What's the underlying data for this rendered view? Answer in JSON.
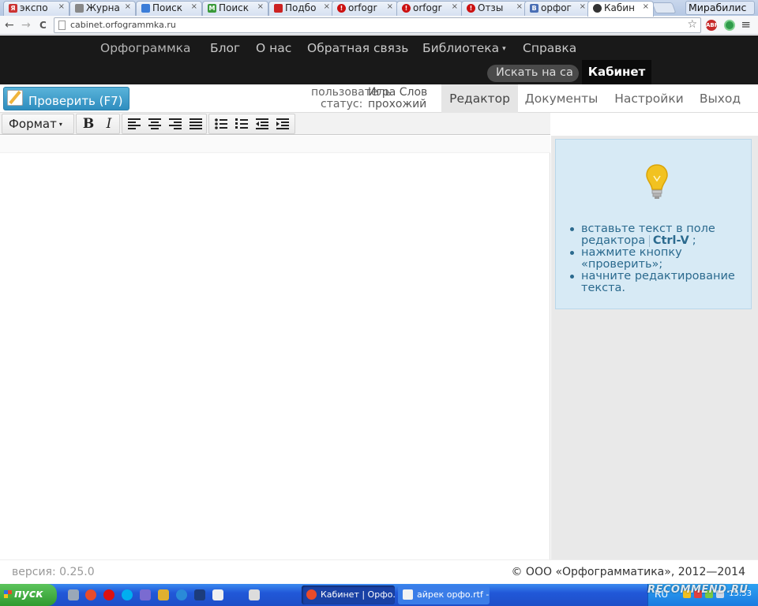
{
  "browser": {
    "tabs": [
      {
        "label": "экспо",
        "favicon_color": "#cc3333",
        "favicon_glyph": "Я"
      },
      {
        "label": "Журна",
        "favicon_color": "#888888",
        "favicon_glyph": ""
      },
      {
        "label": "Поиск",
        "favicon_color": "#3b7dd8",
        "favicon_glyph": ""
      },
      {
        "label": "Поиск",
        "favicon_color": "#3a9a3a",
        "favicon_glyph": "M"
      },
      {
        "label": "Подбо",
        "favicon_color": "#cc2222",
        "favicon_glyph": ""
      },
      {
        "label": "orfogr",
        "favicon_color": "#cc1111",
        "favicon_glyph": "!"
      },
      {
        "label": "orfogr",
        "favicon_color": "#cc1111",
        "favicon_glyph": "!"
      },
      {
        "label": "Отзы",
        "favicon_color": "#cc1111",
        "favicon_glyph": "!"
      },
      {
        "label": "орфог",
        "favicon_color": "#4a6fb5",
        "favicon_glyph": "B"
      },
      {
        "label": "Кабин",
        "favicon_color": "#333333",
        "favicon_glyph": "",
        "active": true
      }
    ],
    "close_glyph": "×",
    "profile_name": "Мирабилис",
    "url": "cabinet.orfogrammka.ru",
    "back_glyph": "←",
    "forward_glyph": "→",
    "reload_glyph": "C",
    "star_glyph": "☆",
    "menu_glyph": "≡",
    "ext_abp_label": "ABP"
  },
  "site_nav": {
    "items": [
      {
        "label": "Орфограммка"
      },
      {
        "label": "Блог"
      },
      {
        "label": "О нас"
      },
      {
        "label": "Обратная связь"
      },
      {
        "label": "Библиотека",
        "dropdown": true
      },
      {
        "label": "Справка"
      }
    ],
    "caret": "▾",
    "search_label": "Искать на са",
    "cabinet_label": "Кабинет"
  },
  "editor_header": {
    "check_button": "Проверить (F7)",
    "user_label": "пользователь",
    "status_label": "статус:",
    "user_name": "Игра Слов",
    "user_status": "прохожий",
    "tabs": [
      {
        "label": "Редактор",
        "active": true
      },
      {
        "label": "Документы"
      },
      {
        "label": "Настройки"
      },
      {
        "label": "Выход"
      }
    ]
  },
  "format_toolbar": {
    "format_label": "Формат",
    "bold": "B",
    "italic": "I"
  },
  "hints": {
    "items": [
      {
        "text": "вставьте текст в поле редактора",
        "kbd": "Ctrl-V",
        "suffix": ";"
      },
      {
        "text": "нажмите кнопку «проверить»;"
      },
      {
        "text": "начните редактирование текста."
      }
    ],
    "bulb_color": "#f2c220"
  },
  "footer": {
    "version": "версия: 0.25.0",
    "copyright": "© ООО «Орфограмматика», 2012—2014"
  },
  "taskbar": {
    "start_label": "пуск",
    "tasks": [
      {
        "label": "Кабинет | Орфо...",
        "active": true
      },
      {
        "label": "айрек орфо.rtf -..."
      }
    ],
    "lang": "RU",
    "clock": "15:53",
    "watermark": "RECOMMEND.RU"
  },
  "colors": {
    "nav_bg": "#191919",
    "accent_blue": "#2f8dbf",
    "hint_bg": "#d7eaf5",
    "hint_text": "#2b6a8e"
  }
}
